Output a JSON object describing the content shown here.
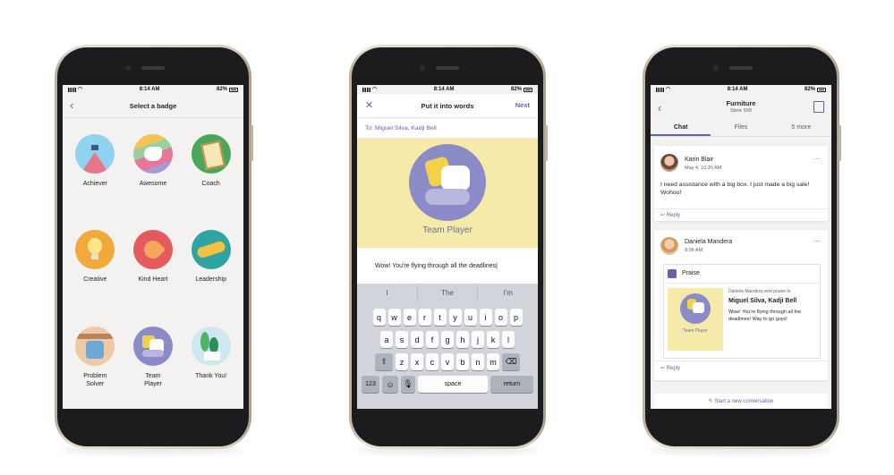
{
  "status": {
    "time": "8:14 AM",
    "battery": "82%"
  },
  "screen1": {
    "title": "Select a badge",
    "badges": [
      {
        "label": "Achiever"
      },
      {
        "label": "Awesome"
      },
      {
        "label": "Coach"
      },
      {
        "label": "Creative"
      },
      {
        "label": "Kind Heart"
      },
      {
        "label": "Leadership"
      },
      {
        "label": "Problem\nSolver"
      },
      {
        "label": "Team\nPlayer"
      },
      {
        "label": "Thank You!"
      }
    ]
  },
  "screen2": {
    "title": "Put it into words",
    "next": "Next",
    "close_icon": "close-icon",
    "to": "To: Miguel Silva, Kadji Bell",
    "card_title": "Team Player",
    "message": "Wow! You're flying through all the deadlines|",
    "suggestions": [
      "I",
      "The",
      "I'm"
    ],
    "rows": [
      [
        "q",
        "w",
        "e",
        "r",
        "t",
        "y",
        "u",
        "i",
        "o",
        "p"
      ],
      [
        "a",
        "s",
        "d",
        "f",
        "g",
        "h",
        "j",
        "k",
        "l"
      ],
      [
        "z",
        "x",
        "c",
        "v",
        "b",
        "n",
        "m"
      ]
    ],
    "numbers_key": "123",
    "space_key": "space",
    "return_key": "return"
  },
  "screen3": {
    "title": "Furniture",
    "subtitle": "Store 599",
    "tabs": [
      "Chat",
      "Files",
      "5 more"
    ],
    "post1": {
      "name": "Karin Blair",
      "time": "May 4, 10:30 AM",
      "text": "I need assistance with a big box. I just made a big sale! Wohoo!",
      "reply": "Reply"
    },
    "post2": {
      "name": "Daniela Mandera",
      "time": "9:06 AM",
      "praise_label": "Praise",
      "praise_from": "Daniela Mandera sent praise to",
      "praise_to": "Miguel Silva, Kadji Bell",
      "praise_msg": "Wow! You're flying through all the deadlines! Way to go guys!",
      "badge_caption": "Team Player",
      "reply": "Reply"
    },
    "new_conversation": "Start a new conversation"
  },
  "colors": {
    "accent": "#6264a7",
    "card_yellow": "#f5eaa9"
  }
}
